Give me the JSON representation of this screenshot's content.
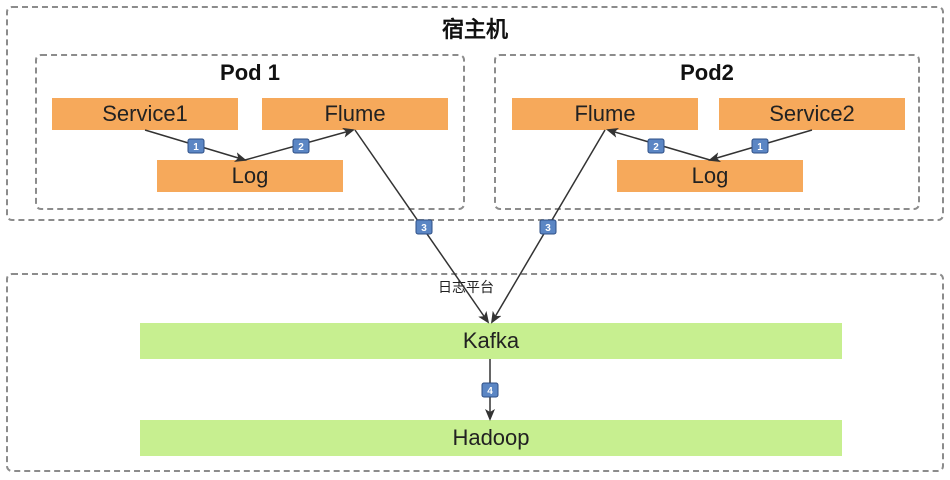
{
  "host": {
    "title": "宿主机"
  },
  "pod1": {
    "title": "Pod 1",
    "service": "Service1",
    "flume": "Flume",
    "log": "Log"
  },
  "pod2": {
    "title": "Pod2",
    "service": "Service2",
    "flume": "Flume",
    "log": "Log"
  },
  "platform": {
    "label": "日志平台",
    "kafka": "Kafka",
    "hadoop": "Hadoop"
  },
  "badges": {
    "pod1_step1": "1",
    "pod1_step2": "2",
    "pod1_step3": "3",
    "pod2_step1": "1",
    "pod2_step2": "2",
    "pod2_step3": "3",
    "step4": "4"
  },
  "colors": {
    "component": "#f6a95b",
    "platform": "#c7ef90",
    "badge": "#5b86c4",
    "border": "#8c8c8c"
  }
}
